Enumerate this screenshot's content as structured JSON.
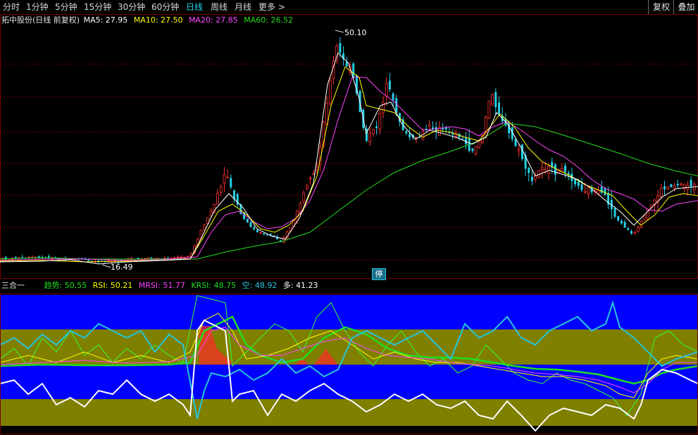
{
  "toolbar": {
    "periods": [
      "分时",
      "1分钟",
      "5分钟",
      "15分钟",
      "30分钟",
      "60分钟",
      "日线",
      "周线",
      "月线",
      "更多 >"
    ],
    "active_period": "日线",
    "fuquan_label": "复权",
    "overlay_label": "叠加"
  },
  "price_panel": {
    "stock_title": "拓中股份(日线 前复权)",
    "ma": [
      {
        "label": "MA5: 27.95",
        "color": "#ffffff"
      },
      {
        "label": "MA10: 27.50",
        "color": "#ffff00"
      },
      {
        "label": "MA20: 27.85",
        "color": "#ff44ff"
      },
      {
        "label": "MA60: 26.52",
        "color": "#22dd22"
      }
    ],
    "high_marker": "50.10",
    "low_marker": "16.49",
    "limit_badge": "停"
  },
  "indicator_panel": {
    "name": "三合一",
    "legend": [
      {
        "label": "趋势: 50.55",
        "color": "#22dd22"
      },
      {
        "label": "RSI: 50.21",
        "color": "#ffff00"
      },
      {
        "label": "MRSI: 51.77",
        "color": "#ff44ff"
      },
      {
        "label": "KRSI: 48.75",
        "color": "#22dd22"
      },
      {
        "label": "空: 48.92",
        "color": "#26c6da"
      },
      {
        "label": "多: 41.23",
        "color": "#ffffff"
      }
    ]
  },
  "colors": {
    "up": "#ff3232",
    "down": "#26d0e6",
    "band_blue": "#0000ff",
    "band_olive": "#7f7f00"
  },
  "chart_data": {
    "type": "candlestick",
    "high": 50.1,
    "low": 16.49,
    "series": [
      {
        "name": "MA5",
        "color": "#ffffff",
        "values": [
          27.95
        ]
      },
      {
        "name": "MA10",
        "color": "#ffff00",
        "values": [
          27.5
        ]
      },
      {
        "name": "MA20",
        "color": "#ff44ff",
        "values": [
          27.85
        ]
      },
      {
        "name": "MA60",
        "color": "#22dd22",
        "values": [
          26.52
        ]
      }
    ]
  }
}
